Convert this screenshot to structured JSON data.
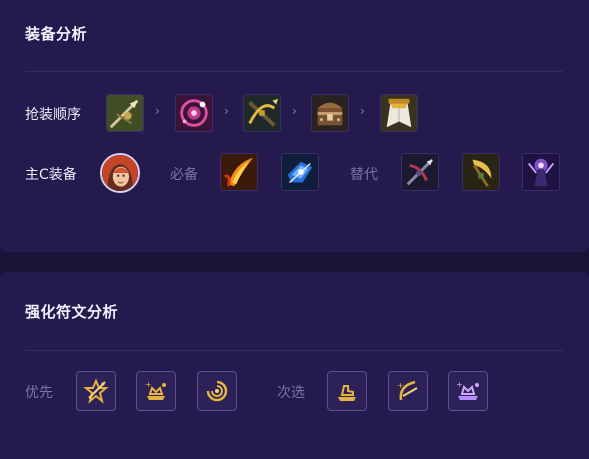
{
  "equipment_analysis": {
    "title": "装备分析",
    "build_order": {
      "label": "抢装顺序",
      "items": [
        {
          "icon": "spear-arrow-item-icon"
        },
        {
          "icon": "pink-rune-circle-item-icon"
        },
        {
          "icon": "golden-crossbow-item-icon"
        },
        {
          "icon": "brown-treasure-chest-item-icon"
        },
        {
          "icon": "white-cloak-item-icon"
        }
      ]
    },
    "carry_items": {
      "label": "主C装备",
      "champion_icon": "red-haired-champion-portrait",
      "required_label": "必备",
      "required_items": [
        {
          "icon": "flaming-blade-item-icon"
        },
        {
          "icon": "blue-gauntlet-item-icon"
        }
      ],
      "alternative_label": "替代",
      "alternative_items": [
        {
          "icon": "dark-crossbow-item-icon"
        },
        {
          "icon": "golden-scythe-item-icon"
        },
        {
          "icon": "violet-mage-item-icon"
        }
      ]
    }
  },
  "augment_analysis": {
    "title": "强化符文分析",
    "primary_label": "优先",
    "primary_augments": [
      {
        "icon": "golden-star-arrow-augment-icon"
      },
      {
        "icon": "golden-crown-platform-augment-icon"
      },
      {
        "icon": "golden-spiral-augment-icon"
      }
    ],
    "secondary_label": "次选",
    "secondary_augments": [
      {
        "icon": "golden-boots-platform-augment-icon"
      },
      {
        "icon": "golden-bow-augment-icon"
      },
      {
        "icon": "purple-crown-platform-augment-icon"
      }
    ]
  },
  "colors": {
    "background": "#1a1237",
    "card": "#241a4d",
    "gold": "#e5b440",
    "muted_text": "#7d72a6"
  }
}
